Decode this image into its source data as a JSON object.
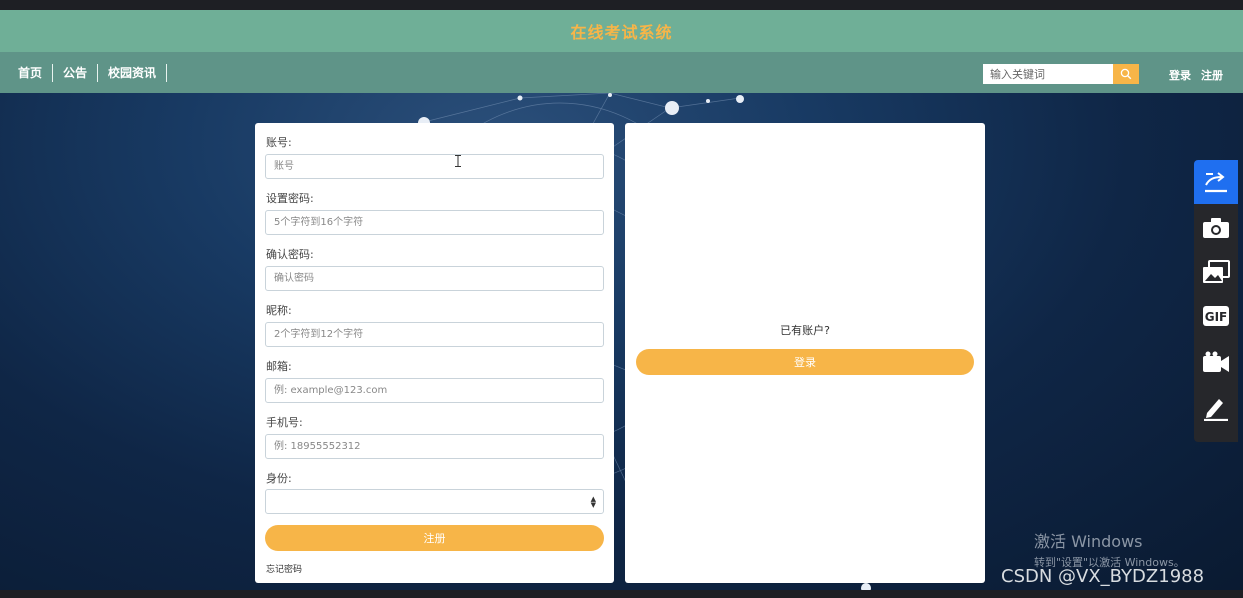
{
  "header": {
    "site_title": "在线考试系统",
    "title_color": "#f7b548",
    "bar_color": "#6faf97",
    "nav_color": "#5f9488"
  },
  "nav": {
    "items": [
      {
        "label": "首页"
      },
      {
        "label": "公告"
      },
      {
        "label": "校园资讯"
      }
    ]
  },
  "search": {
    "placeholder": "输入关键词",
    "icon": "search-icon"
  },
  "auth": {
    "login_label": "登录",
    "register_label": "注册"
  },
  "register_form": {
    "fields": [
      {
        "label": "账号:",
        "placeholder": "账号"
      },
      {
        "label": "设置密码:",
        "placeholder": "5个字符到16个字符"
      },
      {
        "label": "确认密码:",
        "placeholder": "确认密码"
      },
      {
        "label": "昵称:",
        "placeholder": "2个字符到12个字符"
      },
      {
        "label": "邮箱:",
        "placeholder": "例: example@123.com"
      },
      {
        "label": "手机号:",
        "placeholder": "例: 18955552312"
      }
    ],
    "identity_label": "身份:",
    "identity_value": "",
    "submit_label": "注册",
    "forgot_label": "忘记密码"
  },
  "login_panel": {
    "prompt": "已有账户?",
    "login_button": "登录"
  },
  "side_toolbar": {
    "tools": [
      "share-icon",
      "camera-icon",
      "gallery-icon",
      "gif-icon",
      "video-icon",
      "pen-icon"
    ],
    "gif_text": "GIF",
    "active_color": "#1f6ff0"
  },
  "watermark": {
    "windows_title": "激活 Windows",
    "windows_sub": "转到\"设置\"以激活 Windows。",
    "csdn": "CSDN @VX_BYDZ1988"
  },
  "accent_color": "#f7b548"
}
